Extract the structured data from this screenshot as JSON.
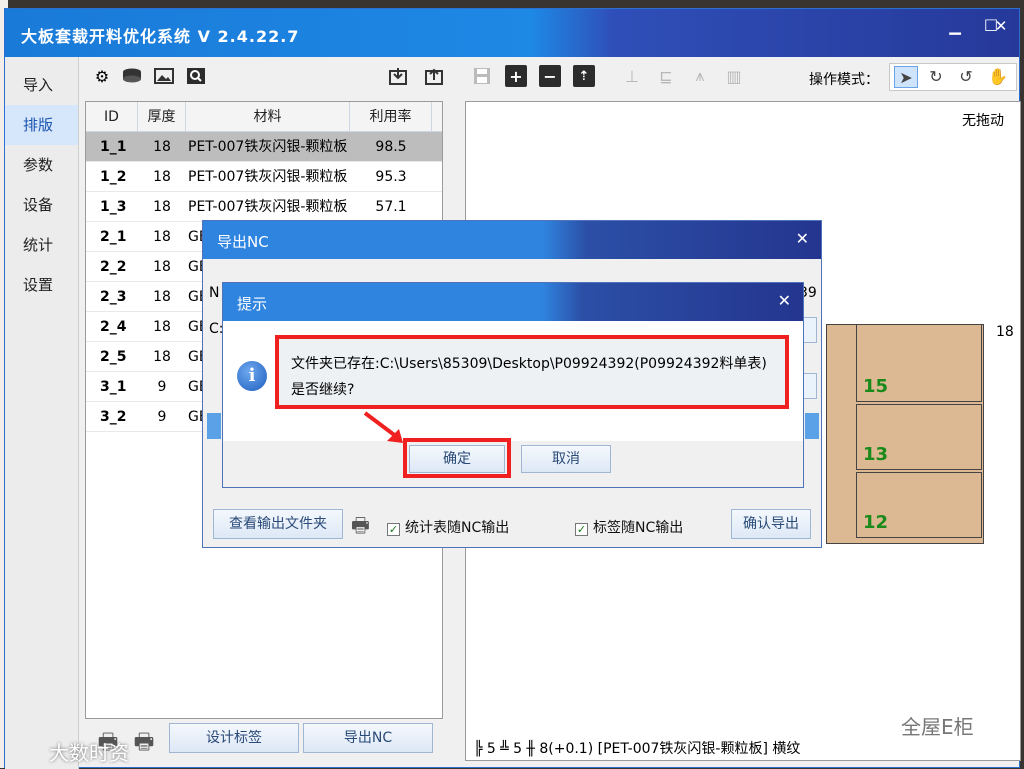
{
  "app": {
    "title": "大板套裁开料优化系统 V 2.4.22.7",
    "window_buttons": {
      "minimize": "▁",
      "maximize": "□",
      "close": "✕"
    }
  },
  "sidebar": {
    "items": [
      {
        "label": "导入"
      },
      {
        "label": "排版",
        "active": true
      },
      {
        "label": "参数"
      },
      {
        "label": "设备"
      },
      {
        "label": "统计"
      },
      {
        "label": "设置"
      }
    ]
  },
  "toolbar": {
    "left_icons": [
      "gear-icon",
      "disk-stack-icon",
      "image-icon",
      "search-image-icon"
    ],
    "file_icons": [
      "import-icon",
      "export-icon"
    ],
    "edit_icons": [
      "save-icon",
      "plus-icon",
      "minus-icon",
      "move-up-icon"
    ],
    "align_icons": [
      "align-icon",
      "sort-icon",
      "chart-icon",
      "bars-icon"
    ],
    "mode_label": "操作模式："
  },
  "list": {
    "columns": [
      "ID",
      "厚度",
      "材料",
      "利用率"
    ],
    "rows": [
      {
        "id": "1_1",
        "thickness": "18",
        "material": "PET-007铁灰闪银-颗粒板",
        "utilization": "98.5",
        "selected": true
      },
      {
        "id": "1_2",
        "thickness": "18",
        "material": "PET-007铁灰闪银-颗粒板",
        "utilization": "95.3"
      },
      {
        "id": "1_3",
        "thickness": "18",
        "material": "PET-007铁灰闪银-颗粒板",
        "utilization": "57.1"
      },
      {
        "id": "2_1",
        "thickness": "18",
        "material": "GE",
        "utilization": ""
      },
      {
        "id": "2_2",
        "thickness": "18",
        "material": "GE",
        "utilization": ""
      },
      {
        "id": "2_3",
        "thickness": "18",
        "material": "GE",
        "utilization": ""
      },
      {
        "id": "2_4",
        "thickness": "18",
        "material": "GE",
        "utilization": ""
      },
      {
        "id": "2_5",
        "thickness": "18",
        "material": "GE",
        "utilization": ""
      },
      {
        "id": "3_1",
        "thickness": "9",
        "material": "GE",
        "utilization": ""
      },
      {
        "id": "3_2",
        "thickness": "9",
        "material": "GE",
        "utilization": ""
      }
    ]
  },
  "bottom": {
    "design_label": "设计标签",
    "export_nc": "导出NC"
  },
  "canvas": {
    "drag_mode": "无拖动",
    "thickness_label": "18",
    "part_numbers": [
      "15",
      "13",
      "12"
    ],
    "status": "╠ 5 ╩ 5   ╫ 8(+0.1)    [PET-007铁灰闪银-颗粒板]  横纹"
  },
  "export_dialog": {
    "title": "导出NC",
    "field_label": "N",
    "path_fragment": "39",
    "field2_label": "C:",
    "view_folder": "查看输出文件夹",
    "stats_check": "统计表随NC输出",
    "label_check": "标签随NC输出",
    "confirm": "确认导出"
  },
  "prompt_dialog": {
    "title": "提示",
    "message_line1": "文件夹已存在:C:\\Users\\85309\\Desktop\\P09924392(P09924392料单表)",
    "message_line2": "是否继续?",
    "ok": "确定",
    "cancel": "取消"
  },
  "watermarks": {
    "bottom_left": "大数时资",
    "bottom_right": "全屋E柜"
  },
  "colors": {
    "titlebar": "#1e88e5",
    "highlight": "#f02020",
    "board": "#dcb992",
    "part_number": "#1a8a1a"
  }
}
